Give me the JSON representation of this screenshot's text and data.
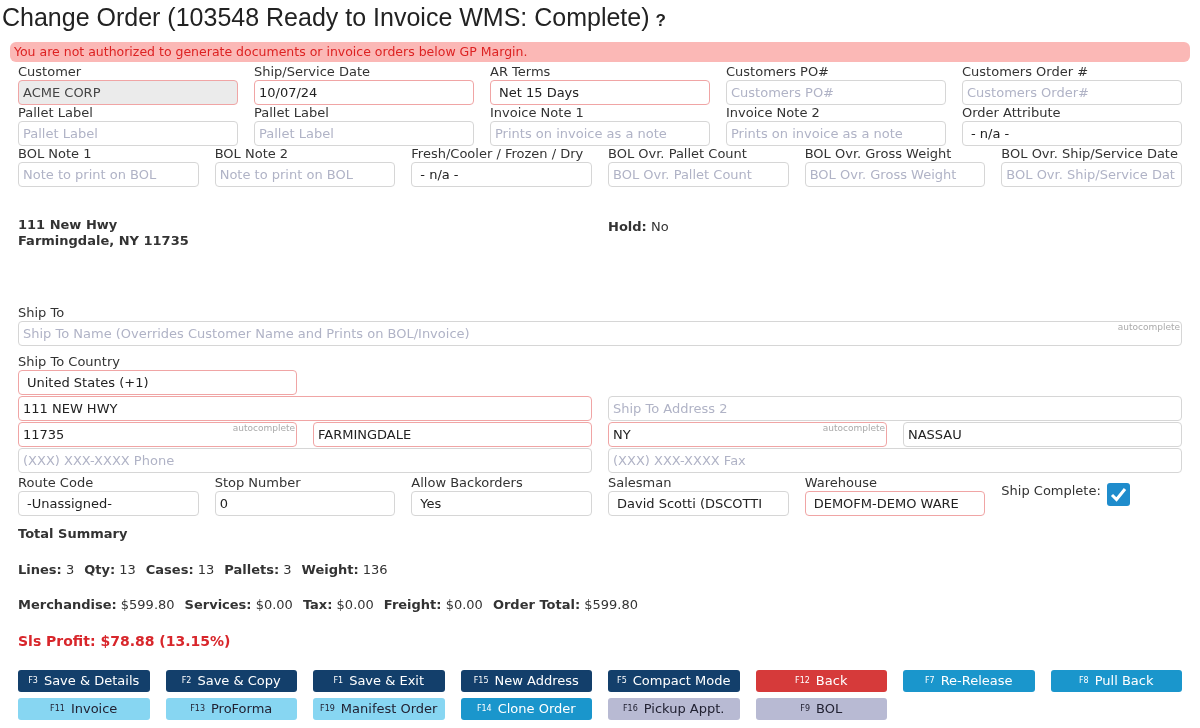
{
  "title": "Change Order (103548 Ready to Invoice WMS: Complete)",
  "help": "?",
  "alert": "You are not authorized to generate documents or invoice orders below GP Margin.",
  "upper_rows": [
    [
      {
        "label": "Customer",
        "kind": "text",
        "value": "ACME CORP",
        "required": true,
        "disabled": true
      },
      {
        "label": "Ship/Service Date",
        "kind": "text",
        "value": "10/07/24",
        "required": true,
        "disabled": false
      },
      {
        "label": "AR Terms",
        "kind": "select",
        "value": "Net 15 Days",
        "required": true,
        "disabled": false
      },
      {
        "label": "Customers PO#",
        "kind": "text",
        "placeholder": "Customers PO#",
        "required": false,
        "disabled": false
      },
      {
        "label": "Customers Order #",
        "kind": "text",
        "placeholder": "Customers Order#",
        "required": false,
        "disabled": false
      }
    ],
    [
      {
        "label": "Pallet Label",
        "kind": "text",
        "placeholder": "Pallet Label",
        "required": false,
        "disabled": false
      },
      {
        "label": "Pallet Label",
        "kind": "text",
        "placeholder": "Pallet Label",
        "required": false,
        "disabled": false
      },
      {
        "label": "Invoice Note 1",
        "kind": "text",
        "placeholder": "Prints on invoice as a note",
        "required": false,
        "disabled": false
      },
      {
        "label": "Invoice Note 2",
        "kind": "text",
        "placeholder": "Prints on invoice as a note",
        "required": false,
        "disabled": false
      },
      {
        "label": "Order Attribute",
        "kind": "select",
        "value": "- n/a -",
        "required": false,
        "disabled": false
      }
    ],
    [
      {
        "label": "BOL Note 1",
        "kind": "text",
        "placeholder": "Note to print on BOL",
        "required": false,
        "disabled": false
      },
      {
        "label": "BOL Note 2",
        "kind": "text",
        "placeholder": "Note to print on BOL",
        "required": false,
        "disabled": false
      },
      {
        "label": "Fresh/Cooler / Frozen / Dry",
        "kind": "select",
        "value": "- n/a -",
        "required": false,
        "disabled": false
      },
      {
        "label": "BOL Ovr. Pallet Count",
        "kind": "text",
        "placeholder": "BOL Ovr. Pallet Count",
        "required": false,
        "disabled": false
      },
      {
        "label": "BOL Ovr. Gross Weight",
        "kind": "text",
        "placeholder": "BOL Ovr. Gross Weight",
        "required": false,
        "disabled": false
      },
      {
        "label": "BOL Ovr. Ship/Service Date",
        "kind": "text",
        "placeholder": "BOL Ovr. Ship/Service Dat",
        "required": false,
        "disabled": false
      }
    ]
  ],
  "bill_to": {
    "lines": [
      "111 New Hwy",
      "Farmingdale, NY 11735"
    ]
  },
  "hold": {
    "label": "Hold:",
    "value": "No"
  },
  "ship_to": {
    "label": "Ship To",
    "kind": "text",
    "placeholder": "Ship To Name (Overrides Customer Name and Prints on BOL/Invoice)",
    "hint": "autocomplete",
    "required": false,
    "disabled": false
  },
  "ship_to_country": {
    "label": "Ship To Country",
    "kind": "select",
    "value": "United States (+1)",
    "required": true,
    "disabled": false
  },
  "address_rows": [
    [
      {
        "kind": "text",
        "value": "111 NEW HWY",
        "required": true,
        "disabled": false
      },
      {
        "kind": "text",
        "placeholder": "Ship To Address 2",
        "required": false,
        "disabled": false
      }
    ],
    [
      {
        "kind": "text",
        "value": "11735",
        "hint": "autocomplete",
        "required": true,
        "disabled": false
      },
      {
        "kind": "text",
        "value": "FARMINGDALE",
        "required": true,
        "disabled": false
      },
      {
        "kind": "text",
        "value": "NY",
        "hint": "autocomplete",
        "required": true,
        "disabled": false
      },
      {
        "kind": "text",
        "value": "NASSAU",
        "required": false,
        "disabled": false
      }
    ],
    [
      {
        "kind": "text",
        "placeholder": "(XXX) XXX-XXXX Phone",
        "required": false,
        "disabled": false
      },
      {
        "kind": "text",
        "placeholder": "(XXX) XXX-XXXX Fax",
        "required": false,
        "disabled": false
      }
    ]
  ],
  "option_row": [
    {
      "label": "Route Code",
      "kind": "select",
      "value": "-Unassigned-",
      "required": false,
      "disabled": false
    },
    {
      "label": "Stop Number",
      "kind": "text",
      "value": "0",
      "required": false,
      "disabled": false
    },
    {
      "label": "Allow Backorders",
      "kind": "select",
      "value": "Yes",
      "required": false,
      "disabled": false
    },
    {
      "label": "Salesman",
      "kind": "select",
      "value": "David Scotti (DSCOTTI",
      "required": false,
      "disabled": false
    },
    {
      "label": "Warehouse",
      "kind": "select",
      "value": "DEMOFM-DEMO WARE",
      "required": true,
      "disabled": false
    },
    {
      "label": "Ship Complete:",
      "kind": "checkbox",
      "checked": true
    }
  ],
  "summary": {
    "title": "Total Summary",
    "lines": [
      [
        {
          "label": "Lines:",
          "value": "3"
        },
        {
          "label": "Qty:",
          "value": "13"
        },
        {
          "label": "Cases:",
          "value": "13"
        },
        {
          "label": "Pallets:",
          "value": "3"
        },
        {
          "label": "Weight:",
          "value": "136"
        }
      ],
      [
        {
          "label": "Merchandise:",
          "value": "$599.80"
        },
        {
          "label": "Services:",
          "value": "$0.00"
        },
        {
          "label": "Tax:",
          "value": "$0.00"
        },
        {
          "label": "Freight:",
          "value": "$0.00"
        },
        {
          "label": "Order Total:",
          "value": "$599.80"
        }
      ]
    ],
    "profit": "Sls Profit: $78.88 (13.15%)"
  },
  "buttons": [
    [
      {
        "key": "F3",
        "label": "Save & Details",
        "kind": "dark"
      },
      {
        "key": "F2",
        "label": "Save & Copy",
        "kind": "dark"
      },
      {
        "key": "F1",
        "label": "Save & Exit",
        "kind": "dark"
      },
      {
        "key": "F15",
        "label": "New Address",
        "kind": "dark"
      },
      {
        "key": "F5",
        "label": "Compact Mode",
        "kind": "dark"
      },
      {
        "key": "F12",
        "label": "Back",
        "kind": "danger"
      },
      {
        "key": "F7",
        "label": "Re-Release",
        "kind": "info"
      },
      {
        "key": "F8",
        "label": "Pull Back",
        "kind": "info"
      }
    ],
    [
      {
        "key": "F11",
        "label": "Invoice",
        "kind": "light"
      },
      {
        "key": "F13",
        "label": "ProForma",
        "kind": "light"
      },
      {
        "key": "F19",
        "label": "Manifest Order",
        "kind": "light"
      },
      {
        "key": "F14",
        "label": "Clone Order",
        "kind": "info"
      },
      {
        "key": "F16",
        "label": "Pickup Appt.",
        "kind": "grey"
      },
      {
        "key": "F9",
        "label": "BOL",
        "kind": "grey"
      }
    ]
  ]
}
